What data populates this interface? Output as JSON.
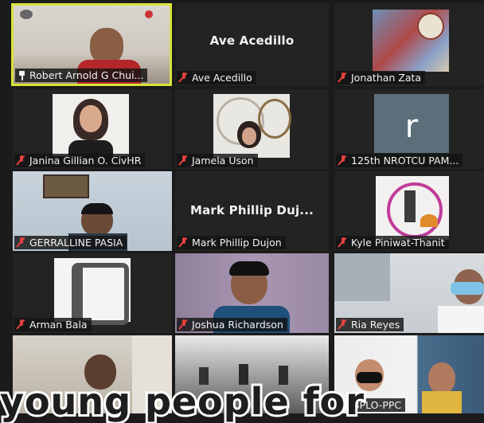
{
  "participants": [
    {
      "name": "Robert Arnold G Chui...",
      "display": "",
      "muted": false,
      "pinned": true,
      "active": true
    },
    {
      "name": "Ave Acedillo",
      "display": "Ave Acedillo",
      "muted": true
    },
    {
      "name": "Jonathan Zata",
      "display": "",
      "muted": true
    },
    {
      "name": "Janina Gillian O. CivHR",
      "display": "",
      "muted": true
    },
    {
      "name": "Jamela Uson",
      "display": "",
      "muted": true
    },
    {
      "name": "125th NROTCU PAM...",
      "display": "",
      "muted": true,
      "initial": "r"
    },
    {
      "name": "GERRALLINE PASIA",
      "display": "",
      "muted": true
    },
    {
      "name": "Mark Phillip Dujon",
      "display": "Mark Phillip Duj...",
      "muted": true
    },
    {
      "name": "Kyle Piniwat-Thanit",
      "display": "",
      "muted": true
    },
    {
      "name": "Arman Bala",
      "display": "",
      "muted": true
    },
    {
      "name": "Joshua Richardson",
      "display": "",
      "muted": true
    },
    {
      "name": "Ria Reyes",
      "display": "",
      "muted": true
    },
    {
      "name": "",
      "display": "",
      "muted": false
    },
    {
      "name": "",
      "display": "",
      "muted": false
    },
    {
      "name": "BPLO-PPC",
      "display": "",
      "muted": false
    }
  ],
  "caption": "young people for",
  "colors": {
    "active_border": "#d9e33a",
    "muted_icon": "#e8423c",
    "background": "#1b1b1b"
  }
}
